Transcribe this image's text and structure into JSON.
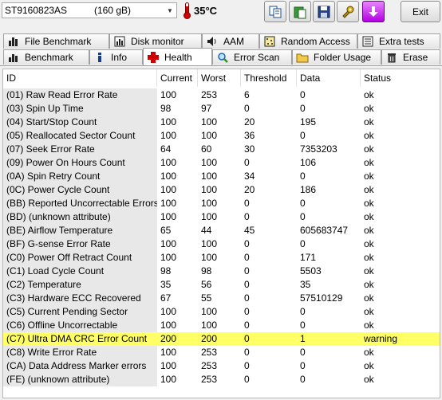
{
  "drive": {
    "name": "ST9160823AS",
    "capacity": "(160 gB)"
  },
  "temperature": "35°C",
  "exit_label": "Exit",
  "toolbar_icons": [
    "copy-icon",
    "paste-icon",
    "save-icon",
    "settings-icon",
    "download-icon"
  ],
  "tabs_row1": [
    {
      "label": "File Benchmark",
      "icon": "file-benchmark-icon"
    },
    {
      "label": "Disk monitor",
      "icon": "chart-icon"
    },
    {
      "label": "AAM",
      "icon": "speaker-icon"
    },
    {
      "label": "Random Access",
      "icon": "random-access-icon"
    },
    {
      "label": "Extra tests",
      "icon": "extra-tests-icon"
    }
  ],
  "tabs_row2": [
    {
      "label": "Benchmark",
      "icon": "benchmark-icon"
    },
    {
      "label": "Info",
      "icon": "info-icon"
    },
    {
      "label": "Health",
      "icon": "health-cross-icon"
    },
    {
      "label": "Error Scan",
      "icon": "magnifier-icon"
    },
    {
      "label": "Folder Usage",
      "icon": "folder-icon"
    },
    {
      "label": "Erase",
      "icon": "trash-icon"
    }
  ],
  "active_tab": "Health",
  "columns": [
    "ID",
    "Current",
    "Worst",
    "Threshold",
    "Data",
    "Status"
  ],
  "rows": [
    [
      "(01) Raw Read Error Rate",
      "100",
      "253",
      "6",
      "0",
      "ok"
    ],
    [
      "(03) Spin Up Time",
      "98",
      "97",
      "0",
      "0",
      "ok"
    ],
    [
      "(04) Start/Stop Count",
      "100",
      "100",
      "20",
      "195",
      "ok"
    ],
    [
      "(05) Reallocated Sector Count",
      "100",
      "100",
      "36",
      "0",
      "ok"
    ],
    [
      "(07) Seek Error Rate",
      "64",
      "60",
      "30",
      "7353203",
      "ok"
    ],
    [
      "(09) Power On Hours Count",
      "100",
      "100",
      "0",
      "106",
      "ok"
    ],
    [
      "(0A) Spin Retry Count",
      "100",
      "100",
      "34",
      "0",
      "ok"
    ],
    [
      "(0C) Power Cycle Count",
      "100",
      "100",
      "20",
      "186",
      "ok"
    ],
    [
      "(BB) Reported Uncorrectable Errors",
      "100",
      "100",
      "0",
      "0",
      "ok"
    ],
    [
      "(BD) (unknown attribute)",
      "100",
      "100",
      "0",
      "0",
      "ok"
    ],
    [
      "(BE) Airflow Temperature",
      "65",
      "44",
      "45",
      "605683747",
      "ok"
    ],
    [
      "(BF) G-sense Error Rate",
      "100",
      "100",
      "0",
      "0",
      "ok"
    ],
    [
      "(C0) Power Off Retract Count",
      "100",
      "100",
      "0",
      "171",
      "ok"
    ],
    [
      "(C1) Load Cycle Count",
      "98",
      "98",
      "0",
      "5503",
      "ok"
    ],
    [
      "(C2) Temperature",
      "35",
      "56",
      "0",
      "35",
      "ok"
    ],
    [
      "(C3) Hardware ECC Recovered",
      "67",
      "55",
      "0",
      "57510129",
      "ok"
    ],
    [
      "(C5) Current Pending Sector",
      "100",
      "100",
      "0",
      "0",
      "ok"
    ],
    [
      "(C6) Offline Uncorrectable",
      "100",
      "100",
      "0",
      "0",
      "ok"
    ],
    [
      "(C7) Ultra DMA CRC Error Count",
      "200",
      "200",
      "0",
      "1",
      "warning"
    ],
    [
      "(C8) Write Error Rate",
      "100",
      "253",
      "0",
      "0",
      "ok"
    ],
    [
      "(CA) Data Address Marker errors",
      "100",
      "253",
      "0",
      "0",
      "ok"
    ],
    [
      "(FE) (unknown attribute)",
      "100",
      "253",
      "0",
      "0",
      "ok"
    ]
  ],
  "colors": {
    "warning_highlight": "#ffff66",
    "id_column_bg": "#e8e8e8"
  }
}
